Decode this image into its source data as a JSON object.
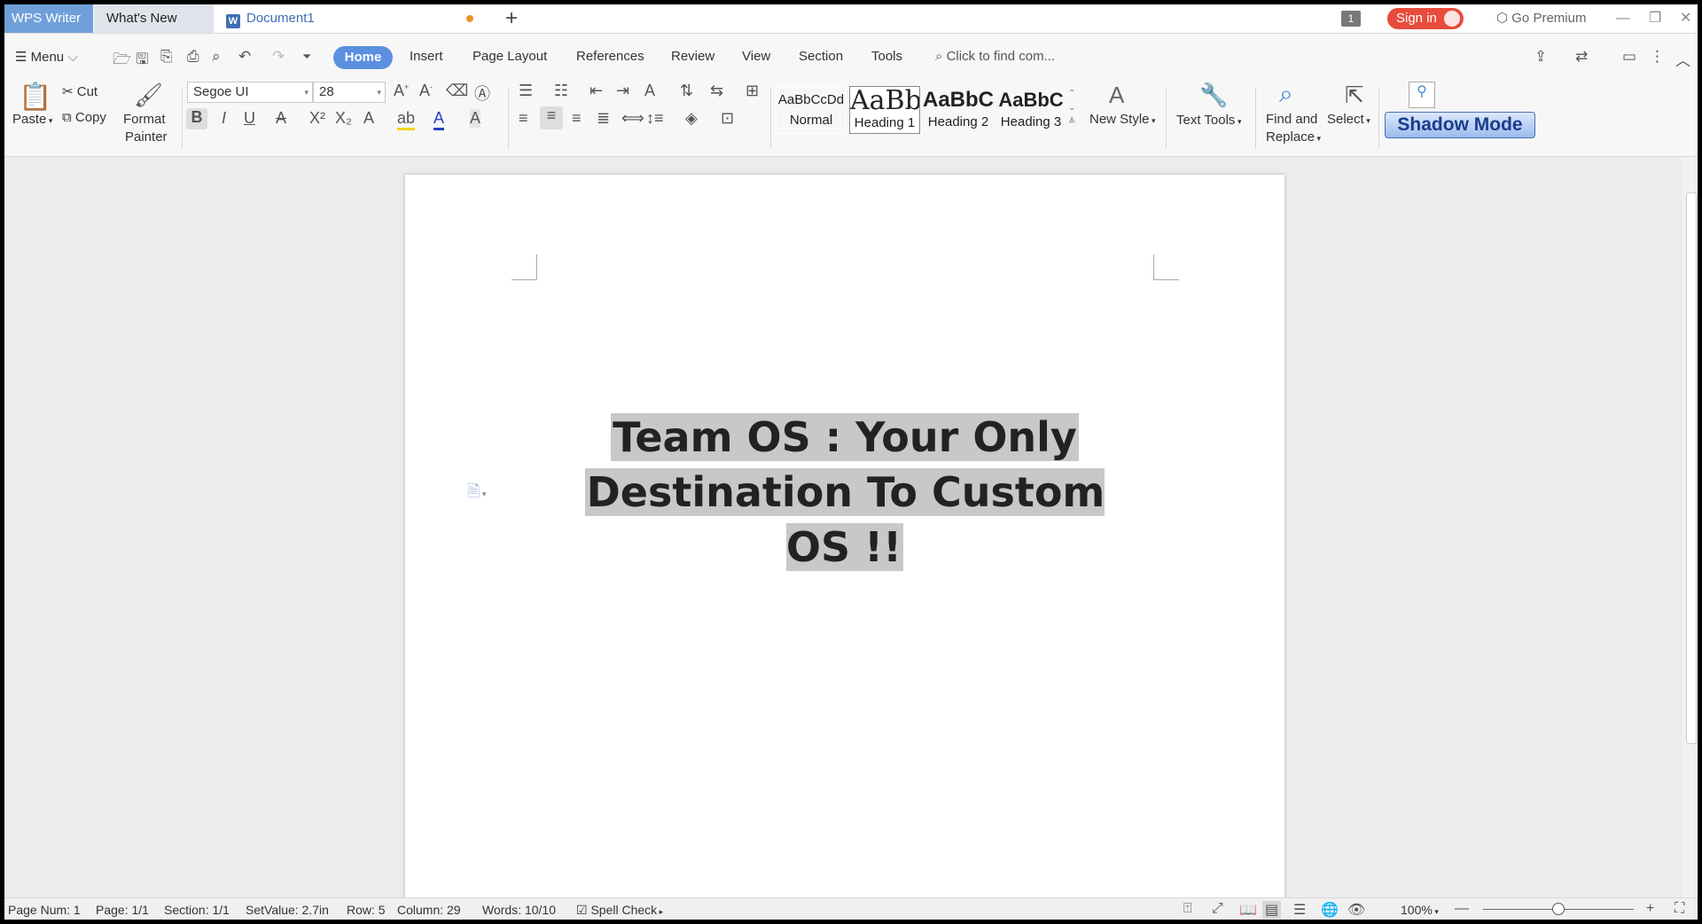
{
  "titlebar": {
    "app_tab": "WPS Writer",
    "whats_new_tab": "What's New",
    "doc_tab": "Document1",
    "doc_tab_icon": "W",
    "notif_badge": "1",
    "sign_in": "Sign in",
    "go_premium": "Go Premium"
  },
  "menu": {
    "menu_label": "Menu",
    "tabs": [
      "Home",
      "Insert",
      "Page Layout",
      "References",
      "Review",
      "View",
      "Section",
      "Tools"
    ],
    "search_placeholder": "Click to find com..."
  },
  "ribbon": {
    "paste": "Paste",
    "cut": "Cut",
    "copy": "Copy",
    "format_painter_1": "Format",
    "format_painter_2": "Painter",
    "font_name": "Segoe UI",
    "font_size": "28",
    "styles": [
      {
        "preview": "AaBbCcDd",
        "label": "Normal"
      },
      {
        "preview": "AaBb",
        "label": "Heading 1"
      },
      {
        "preview": "AaBbC",
        "label": "Heading 2"
      },
      {
        "preview": "AaBbC",
        "label": "Heading 3"
      }
    ],
    "new_style": "New Style",
    "text_tools": "Text Tools",
    "find_replace_1": "Find and",
    "find_replace_2": "Replace",
    "select": "Select",
    "shadow_mode": "Shadow Mode"
  },
  "document": {
    "heading_line1": "Team OS : Your Only",
    "heading_line2": "Destination To Custom OS !!"
  },
  "status": {
    "page_num": "Page Num: 1",
    "page": "Page: 1/1",
    "section": "Section: 1/1",
    "set_value": "SetValue: 2.7in",
    "row": "Row: 5",
    "column": "Column: 29",
    "words": "Words: 10/10",
    "spell_check": "Spell Check",
    "zoom": "100%",
    "zoom_level": 0.5
  },
  "colors": {
    "accent": "#5b90e0",
    "sign_in": "#e74c3c",
    "app_tab": "#6f9fd8"
  }
}
